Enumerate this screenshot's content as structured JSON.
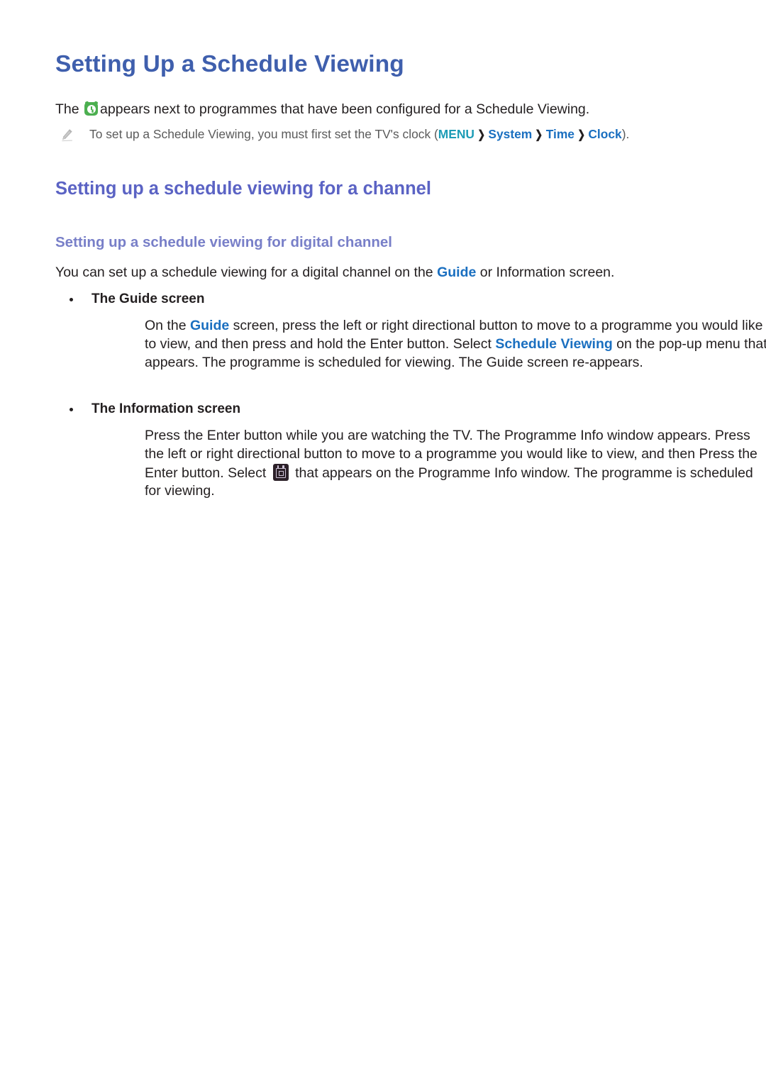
{
  "document": {
    "title": "Setting Up a Schedule Viewing",
    "intro": {
      "before_icon": "The ",
      "icon": "schedule-clock-icon",
      "after_icon": "appears next to programmes that have been configured for a Schedule Viewing."
    },
    "note": {
      "icon": "pencil-icon",
      "text_before": "To set up a Schedule Viewing, you must first set the TV's clock (",
      "path": [
        "MENU",
        "System",
        "Time",
        "Clock"
      ],
      "separator": "❯",
      "text_after": ")."
    },
    "section": {
      "title": "Setting up a schedule viewing for a channel",
      "subsection_title": "Setting up a schedule viewing for digital channel",
      "lead": {
        "part1": "You can set up a schedule viewing for a digital channel on the ",
        "link": "Guide",
        "part2": " or Information screen."
      },
      "bullets": [
        {
          "label": "The Guide screen",
          "body": {
            "part1": "On the ",
            "link1": "Guide",
            "part2": " screen, press the left or right directional button to move to a programme you would like to view, and then press and hold the Enter button. Select ",
            "link2": "Schedule Viewing",
            "part3": " on the pop-up menu that appears. The programme is scheduled for viewing. The Guide screen re-appears."
          }
        },
        {
          "label": "The Information screen",
          "body": {
            "part1": "Press the Enter button while you are watching the TV. The Programme Info window appears. Press the left or right directional button to move to a programme you would like to view, and then Press the Enter button. Select ",
            "icon": "calendar-schedule-icon",
            "part2": " that appears on the Programme Info window. The programme is scheduled for viewing."
          }
        }
      ]
    }
  },
  "colors": {
    "title": "#3f5fad",
    "section_heading": "#5b63c4",
    "subsection_heading": "#787fc8",
    "link_blue": "#1a6fc0",
    "link_teal": "#1d9cb6",
    "body_text": "#231f20",
    "note_text": "#5b5b5b",
    "clock_icon_green": "#4caf50",
    "calendar_icon_dark": "#2b2028",
    "page_background": "#ffffff"
  }
}
